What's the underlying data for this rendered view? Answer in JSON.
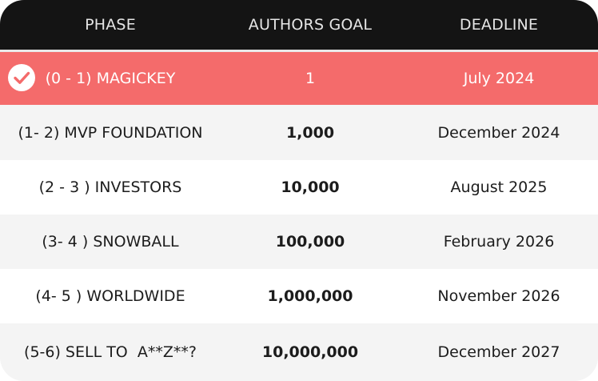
{
  "header": {
    "phase": "PHASE",
    "authors_goal": "AUTHORS GOAL",
    "deadline": "DEADLINE"
  },
  "rows": [
    {
      "phase": "(0 - 1) MAGICKEY",
      "goal": "1",
      "deadline": "July 2024",
      "completed": true
    },
    {
      "phase": "(1- 2) MVP FOUNDATION",
      "goal": "1,000",
      "deadline": "December 2024"
    },
    {
      "phase": "(2 - 3 ) INVESTORS",
      "goal": "10,000",
      "deadline": "August 2025"
    },
    {
      "phase": "(3- 4 ) SNOWBALL",
      "goal": "100,000",
      "deadline": "February 2026"
    },
    {
      "phase": "(4- 5 ) WORLDWIDE",
      "goal": "1,000,000",
      "deadline": "November 2026"
    },
    {
      "phase": "(5-6) SELL TO  A**Z**?",
      "goal": "10,000,000",
      "deadline": "December 2027"
    }
  ],
  "colors": {
    "header_bg": "#141414",
    "highlight_bg": "#f46b6b",
    "row_white": "#ffffff",
    "row_gray": "#f4f4f4"
  },
  "icons": {
    "completed": "check-circle-icon"
  }
}
